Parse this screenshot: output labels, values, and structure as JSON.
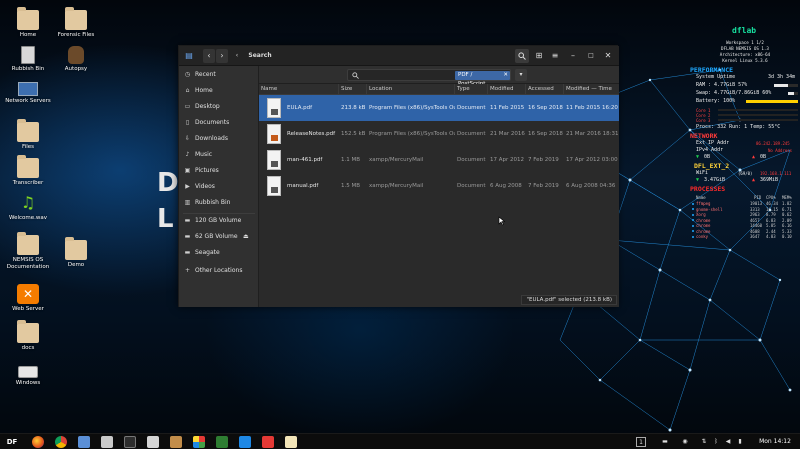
{
  "desktop": {
    "icons": [
      {
        "label": "Home"
      },
      {
        "label": "Forensic Files"
      },
      {
        "label": "Rubbish Bin"
      },
      {
        "label": "Autopsy"
      },
      {
        "label": "Network Servers"
      },
      {
        "label": "Files"
      },
      {
        "label": "Transcriber"
      },
      {
        "label": "Welcome.wav"
      },
      {
        "label": "NEMSIS OS Documentation"
      },
      {
        "label": "Demo"
      },
      {
        "label": "Web Server"
      },
      {
        "label": "docs"
      },
      {
        "label": "Windows"
      }
    ]
  },
  "file_manager": {
    "title": "Search",
    "search_filter": "PDF / PostScript",
    "sidebar": [
      {
        "label": "Recent",
        "icon": "clock-icon"
      },
      {
        "label": "Home",
        "icon": "home-icon"
      },
      {
        "label": "Desktop",
        "icon": "desktop-icon"
      },
      {
        "label": "Documents",
        "icon": "documents-icon"
      },
      {
        "label": "Downloads",
        "icon": "downloads-icon"
      },
      {
        "label": "Music",
        "icon": "music-icon"
      },
      {
        "label": "Pictures",
        "icon": "pictures-icon"
      },
      {
        "label": "Videos",
        "icon": "videos-icon"
      },
      {
        "label": "Rubbish Bin",
        "icon": "trash-icon"
      },
      {
        "label": "120 GB Volume",
        "icon": "drive-icon"
      },
      {
        "label": "62 GB Volume",
        "icon": "drive-icon"
      },
      {
        "label": "Seagate",
        "icon": "drive-icon"
      },
      {
        "label": "Other Locations",
        "icon": "plus-icon"
      }
    ],
    "columns": [
      "Name",
      "Size",
      "Location",
      "Type",
      "Modified",
      "Accessed",
      "Modified — Time"
    ],
    "rows": [
      {
        "name": "EULA.pdf",
        "size": "213.8 kB",
        "location": "Program Files (x86)/SysTools Ou",
        "type": "Document",
        "modified": "11 Feb 2015",
        "accessed": "16 Sep 2018",
        "modified_time": "11 Feb 2015 16:20",
        "selected": true
      },
      {
        "name": "ReleaseNotes.pdf",
        "size": "152.5 kB",
        "location": "Program Files (x86)/SysTools Ou",
        "type": "Document",
        "modified": "21 Mar 2016",
        "accessed": "16 Sep 2018",
        "modified_time": "21 Mar 2016 18:31",
        "selected": false
      },
      {
        "name": "man-461.pdf",
        "size": "1.1 MB",
        "location": "xampp/MercuryMail",
        "type": "Document",
        "modified": "17 Apr 2012",
        "accessed": "7 Feb 2019",
        "modified_time": "17 Apr 2012 03:00",
        "selected": false
      },
      {
        "name": "manual.pdf",
        "size": "1.5 MB",
        "location": "xampp/MercuryMail",
        "type": "Document",
        "modified": "6 Aug 2008",
        "accessed": "7 Feb 2019",
        "modified_time": "6 Aug 2008 04:36",
        "selected": false
      }
    ],
    "status": "\"EULA.pdf\" selected (213.8 kB)"
  },
  "conky": {
    "host": "dflab",
    "info": [
      "Workspace 1 1/2",
      "DFLAB NEMSIS OS 1.3",
      "Architecture: x86-64",
      "Kernel Linux 5.3.6"
    ],
    "performance": {
      "heading": "PERFORMANCE",
      "uptime_label": "System Uptime",
      "uptime_value": "3d 3h 34m",
      "ram_label": "RAM : 4.77GiB 57%",
      "ram_pct": 57,
      "swap_label": "Swap: 4.77GiB/7.86GiB 60%",
      "swap_pct": 60,
      "battery_label": "Battery: 100%",
      "battery_pct": 100,
      "cores": [
        "Core 1",
        "Core 2",
        "Core 3"
      ],
      "procs": "Procs: 332  Run: 1 Temp: 55°C"
    },
    "network": {
      "heading": "NETWORK",
      "ext_ip_label": "Ext IP Addr",
      "ext_ip_value": "86.242.189.245",
      "ipv4_label": "IPv4 Addr",
      "ipv4_value": "No Address",
      "up": "0B",
      "down": "0B"
    },
    "wifi": {
      "heading": "DFL_EXT_2",
      "wifi_label": "WiFi",
      "wifi_value": "(69/0)",
      "wifi_addr": "192.168.1.111",
      "down": "3.47GiB",
      "up": "369MiB"
    },
    "processes": {
      "heading": "PROCESSES",
      "columns": [
        "Name",
        "PID",
        "CPU%",
        "MEM%"
      ],
      "rows": [
        [
          "ffmpeg",
          "19013",
          "46.34",
          "1.82"
        ],
        [
          "gnome-shell",
          "3313",
          "14.15",
          "6.71"
        ],
        [
          "Xorg",
          "2963",
          "8.79",
          "0.62"
        ],
        [
          "chrome",
          "4657",
          "6.83",
          "2.09"
        ],
        [
          "chrome",
          "14460",
          "5.85",
          "6.16"
        ],
        [
          "chrome",
          "4608",
          "2.44",
          "5.33"
        ],
        [
          "conky",
          "3647",
          "4.83",
          "0.10"
        ]
      ]
    }
  },
  "taskbar": {
    "start_label": "DF",
    "workspace": "1",
    "clock": "Mon 14:12"
  },
  "colors": {
    "selection": "#2f63a8",
    "conky_title": "#17e0a0",
    "conky_performance": "#1fa8ff",
    "conky_network": "#ff3a3a",
    "conky_wifi": "#ffd23a",
    "conky_processes": "#ff2a2a"
  }
}
